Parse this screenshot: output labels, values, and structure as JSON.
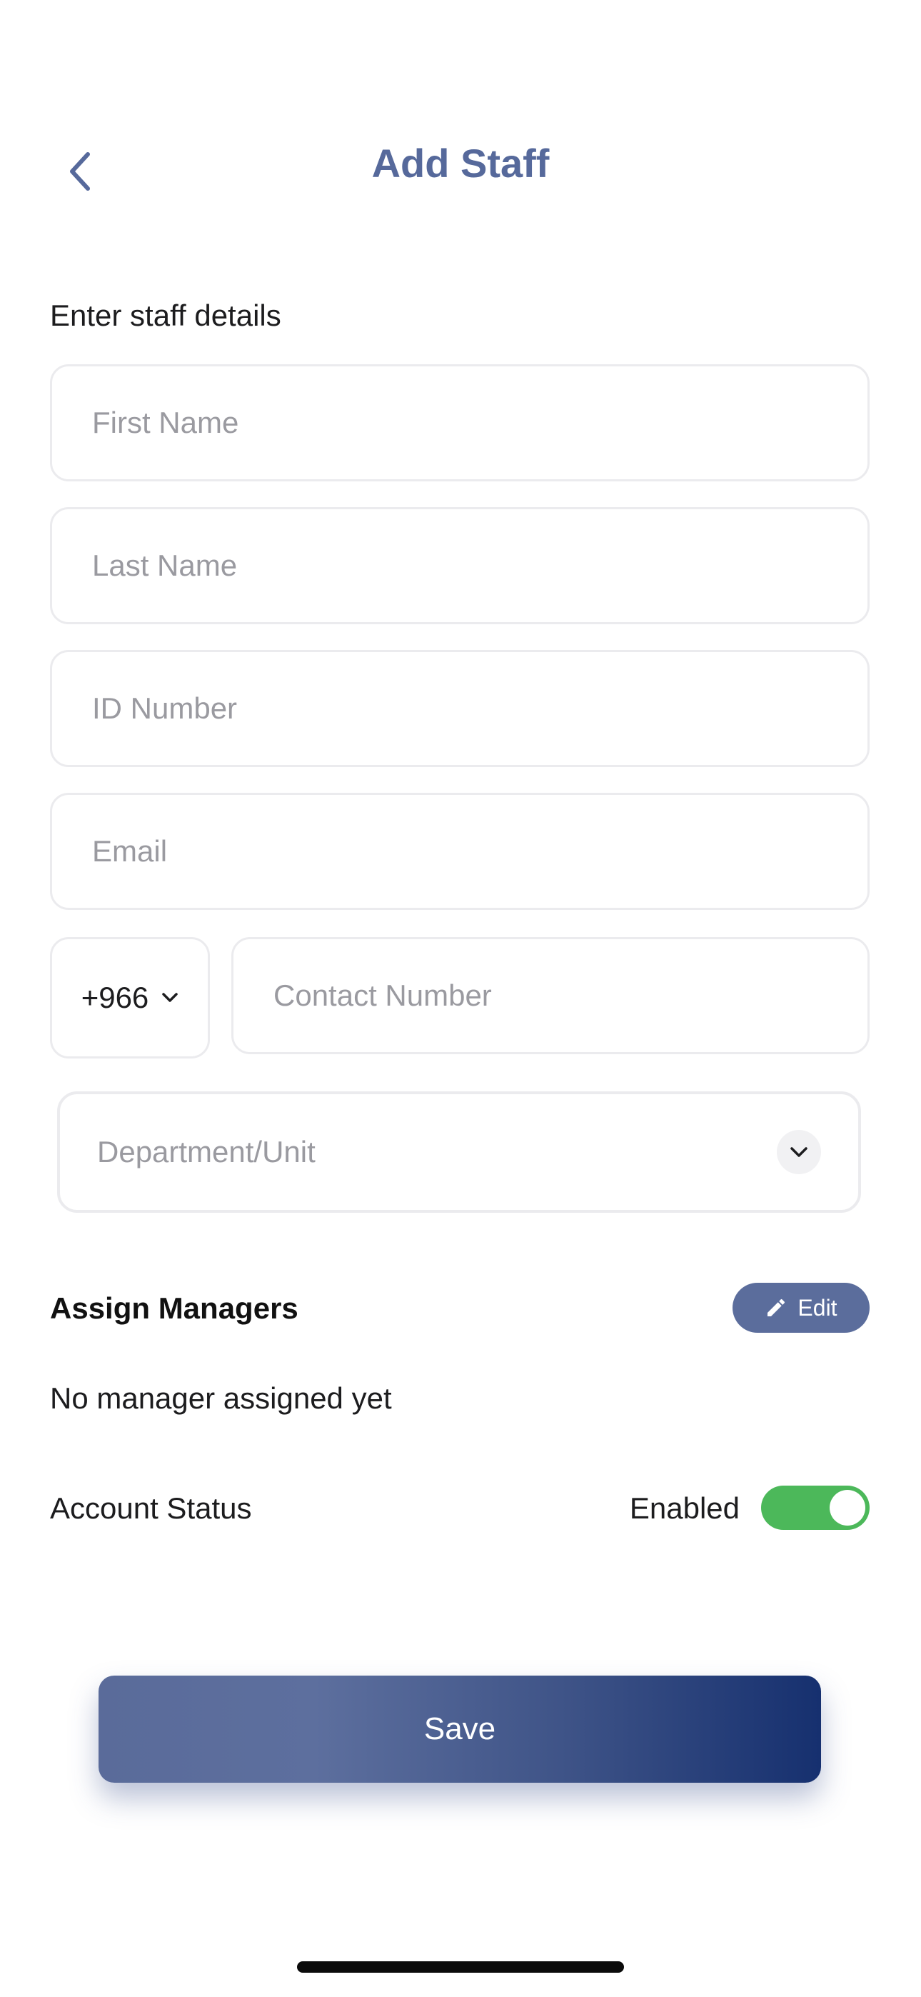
{
  "header": {
    "title": "Add Staff",
    "back_icon": "chevron-left-icon"
  },
  "form": {
    "section_label": "Enter staff details",
    "first_name": {
      "value": "",
      "placeholder": "First Name"
    },
    "last_name": {
      "value": "",
      "placeholder": "Last Name"
    },
    "id_number": {
      "value": "",
      "placeholder": "ID Number"
    },
    "email": {
      "value": "",
      "placeholder": "Email"
    },
    "country_code": "+966",
    "contact_number": {
      "value": "",
      "placeholder": "Contact Number"
    },
    "department": {
      "placeholder": "Department/Unit"
    }
  },
  "managers": {
    "title": "Assign Managers",
    "edit_label": "Edit",
    "empty_text": "No manager assigned yet"
  },
  "account_status": {
    "label": "Account Status",
    "value": "Enabled",
    "enabled": true
  },
  "save_label": "Save",
  "colors": {
    "title": "#56699b",
    "edit_button": "#5b6d9c",
    "toggle_on": "#4cb85a",
    "save_gradient_start": "#5a6b9a",
    "save_gradient_end": "#16306f"
  }
}
